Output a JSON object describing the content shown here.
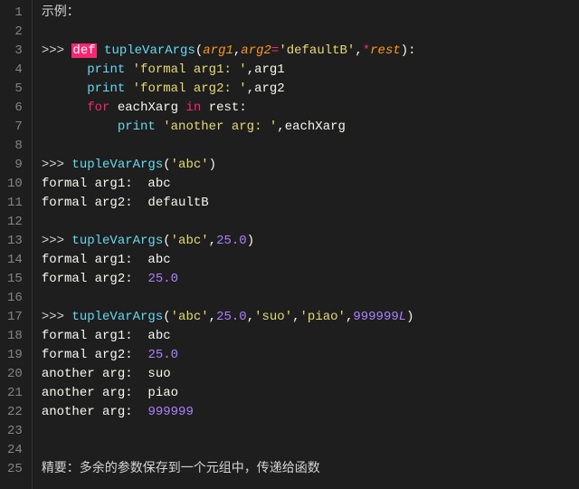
{
  "colors": {
    "bg": "#1e1e1e",
    "fg": "#d4d4d4",
    "gutter": "#858585",
    "keyword": "#f92672",
    "function": "#66d9ef",
    "param": "#fd971f",
    "string": "#e6db74",
    "number": "#ae81ff",
    "plain": "#f8f8f2"
  },
  "gutter": [
    "1",
    "2",
    "3",
    "4",
    "5",
    "6",
    "7",
    "8",
    "9",
    "10",
    "11",
    "12",
    "13",
    "14",
    "15",
    "16",
    "17",
    "18",
    "19",
    "20",
    "21",
    "22",
    "23",
    "24",
    "25"
  ],
  "l1": "示例：",
  "l3": {
    "prompt": ">>> ",
    "def": "def",
    "sp": " ",
    "fn": "tupleVarArgs",
    "open": "(",
    "a1": "arg1",
    "comma1": ",",
    "a2": "arg2",
    "eq": "=",
    "defv": "'defaultB'",
    "comma2": ",",
    "star": "*",
    "rest": "rest",
    "close": "):"
  },
  "l4": {
    "indent": "      ",
    "print": "print",
    "sp": " ",
    "str": "'formal arg1: '",
    "comma": ",",
    "var": "arg1"
  },
  "l5": {
    "indent": "      ",
    "print": "print",
    "sp": " ",
    "str": "'formal arg2: '",
    "comma": ",",
    "var": "arg2"
  },
  "l6": {
    "indent": "      ",
    "for": "for",
    "sp1": " ",
    "var": "eachXarg",
    "sp2": " ",
    "in": "in",
    "sp3": " ",
    "rest": "rest",
    "colon": ":"
  },
  "l7": {
    "indent": "          ",
    "print": "print",
    "sp": " ",
    "str": "'another arg: '",
    "comma": ",",
    "var": "eachXarg"
  },
  "l9": {
    "prompt": ">>> ",
    "fn": "tupleVarArgs",
    "open": "(",
    "a1": "'abc'",
    "close": ")"
  },
  "l10": "formal arg1:  abc",
  "l11": "formal arg2:  defaultB",
  "l13": {
    "prompt": ">>> ",
    "fn": "tupleVarArgs",
    "open": "(",
    "a1": "'abc'",
    "c1": ",",
    "a2": "25.0",
    "close": ")"
  },
  "l14a": "formal arg1:  abc",
  "l14b": "formal arg2:  ",
  "l14c": "25.0",
  "l17": {
    "prompt": ">>> ",
    "fn": "tupleVarArgs",
    "open": "(",
    "a1": "'abc'",
    "c1": ",",
    "a2": "25.0",
    "c2": ",",
    "a3": "'suo'",
    "c3": ",",
    "a4": "'piao'",
    "c4": ",",
    "a5": "999999",
    "a5s": "L",
    "close": ")"
  },
  "l18": "formal arg1:  abc",
  "l19a": "formal arg2:  ",
  "l19b": "25.0",
  "l20": "another arg:  suo",
  "l21": "another arg:  piao",
  "l22a": "another arg:  ",
  "l22b": "999999",
  "l25": "精要：多余的参数保存到一个元组中，传递给函数"
}
